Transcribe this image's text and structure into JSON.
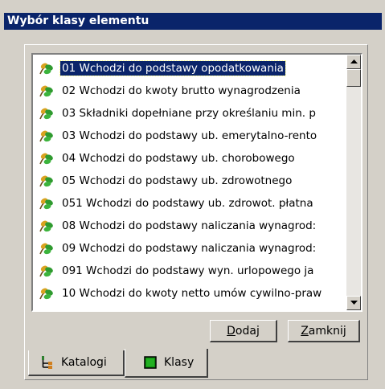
{
  "window": {
    "title": "Wybór klasy elementu"
  },
  "list": {
    "items": [
      "01 Wchodzi do podstawy opodatkowania",
      "02 Wchodzi do kwoty brutto wynagrodzenia",
      "03 Składniki dopełniane przy określaniu min. p",
      "03 Wchodzi do podstawy ub. emerytalno-rento",
      "04 Wchodzi do podstawy ub. chorobowego",
      "05 Wchodzi do podstawy ub. zdrowotnego",
      "051 Wchodzi do podstawy ub. zdrowot. płatna",
      "08 Wchodzi do podstawy naliczania wynagrod:",
      "09 Wchodzi do podstawy naliczania wynagrod:",
      "091 Wchodzi do podstawy wyn. urlopowego ja",
      "10 Wchodzi do kwoty netto umów cywilno-praw"
    ],
    "selected_index": 0,
    "item_icon": "leaf-icon"
  },
  "buttons": {
    "add": {
      "hotkey": "D",
      "rest": "odaj"
    },
    "close": {
      "hotkey": "Z",
      "rest": "amknij"
    }
  },
  "tabs": [
    {
      "label": "Katalogi",
      "icon": "tree-icon",
      "active": false
    },
    {
      "label": "Klasy",
      "icon": "green-square-icon",
      "active": true
    }
  ],
  "colors": {
    "titlebar": "#0a246a",
    "selection": "#0a246a",
    "face": "#d4d0c8"
  }
}
